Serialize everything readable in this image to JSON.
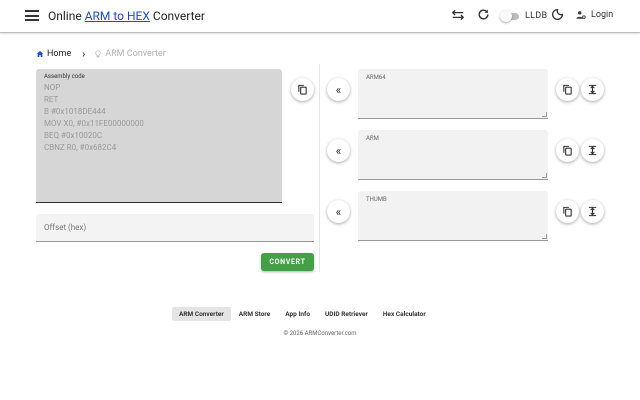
{
  "header": {
    "title_prefix": "Online ",
    "title_link": "ARM to HEX",
    "title_suffix": " Converter",
    "lldb_label": "LLDB",
    "login_label": "Login",
    "icons": [
      "menu-icon",
      "swap-horizontal-icon",
      "refresh-icon",
      "dark-mode-icon",
      "user-icon"
    ]
  },
  "breadcrumb": {
    "home": "Home",
    "current": "ARM Converter"
  },
  "assembly": {
    "label": "Assembly code",
    "code": "NOP\nRET\nB #0x1018DE444\nMOV X0, #0x11FE00000000\nBEQ #0x10020C\nCBNZ R0, #0x682C4"
  },
  "offset": {
    "placeholder": "Offset (hex)"
  },
  "convert_label": "CONVERT",
  "outputs": [
    {
      "label": "ARM64",
      "value": ""
    },
    {
      "label": "ARM",
      "value": ""
    },
    {
      "label": "THUMB",
      "value": ""
    }
  ],
  "footer": {
    "nav": [
      "ARM Converter",
      "ARM Store",
      "App Info",
      "UDID Retriever",
      "Hex Calculator"
    ],
    "active": "ARM Converter",
    "copyright": "© 2026 ARMConverter.com"
  },
  "colors": {
    "accent_link": "#1a4bd6",
    "convert_button": "#43a047",
    "assembly_bg": "#d6d6d6"
  }
}
